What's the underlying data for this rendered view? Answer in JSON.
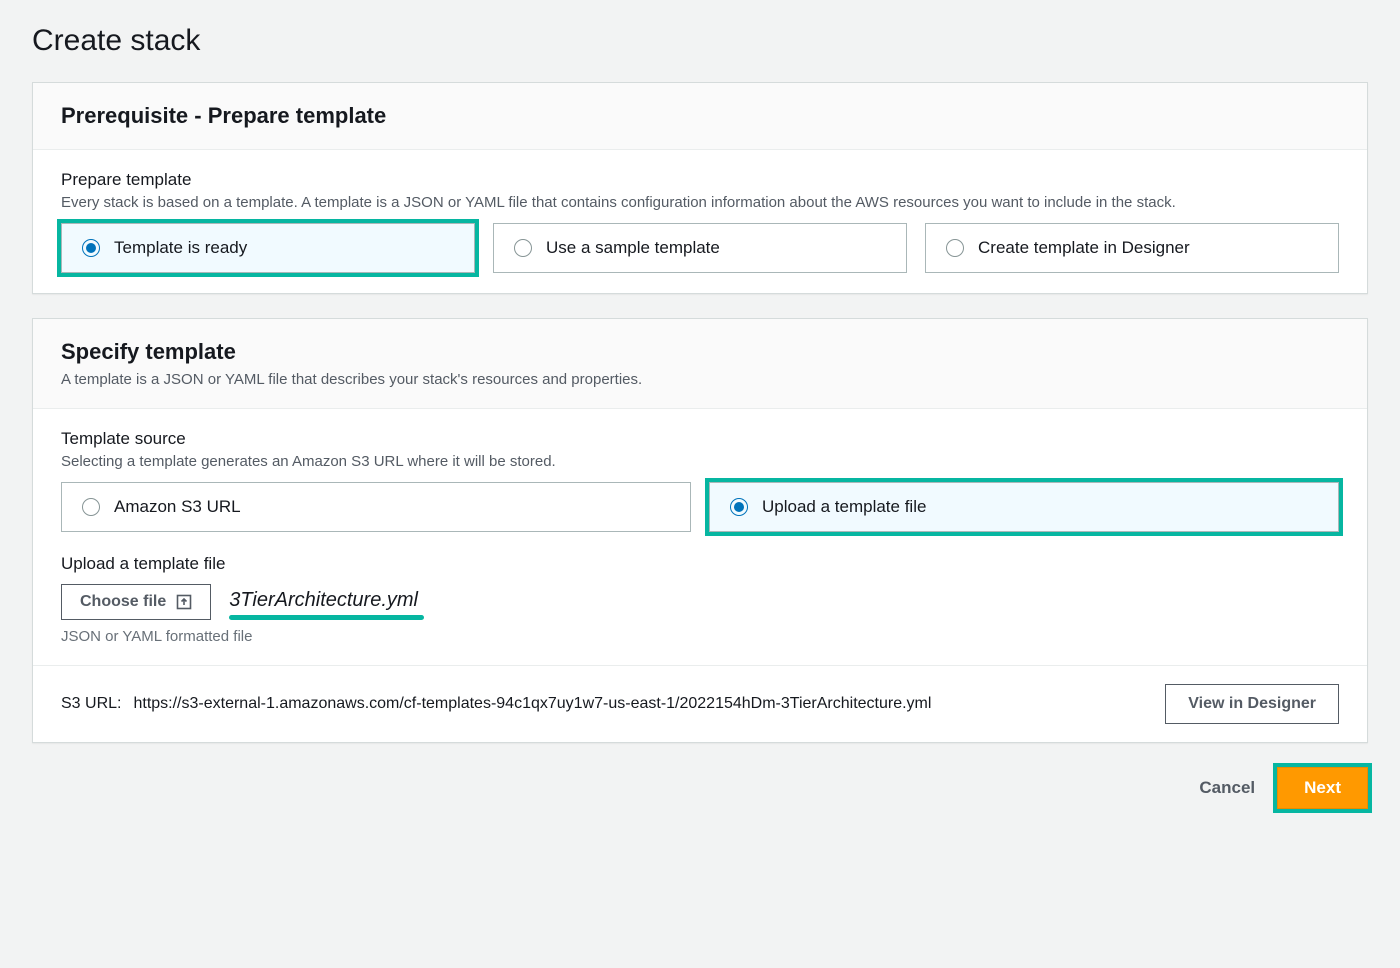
{
  "page_title": "Create stack",
  "panel1": {
    "title": "Prerequisite - Prepare template",
    "field_label": "Prepare template",
    "field_desc": "Every stack is based on a template. A template is a JSON or YAML file that contains configuration information about the AWS resources you want to include in the stack.",
    "options": {
      "ready": "Template is ready",
      "sample": "Use a sample template",
      "designer": "Create template in Designer"
    }
  },
  "panel2": {
    "title": "Specify template",
    "subtitle": "A template is a JSON or YAML file that describes your stack's resources and properties.",
    "source_label": "Template source",
    "source_desc": "Selecting a template generates an Amazon S3 URL where it will be stored.",
    "options": {
      "s3url": "Amazon S3 URL",
      "upload": "Upload a template file"
    },
    "upload_label": "Upload a template file",
    "choose_file": "Choose file",
    "filename": "3TierArchitecture.yml",
    "file_hint": "JSON or YAML formatted file",
    "s3_url_label": "S3 URL:",
    "s3_url_value": "https://s3-external-1.amazonaws.com/cf-templates-94c1qx7uy1w7-us-east-1/2022154hDm-3TierArchitecture.yml",
    "view_designer": "View in Designer"
  },
  "actions": {
    "cancel": "Cancel",
    "next": "Next"
  }
}
